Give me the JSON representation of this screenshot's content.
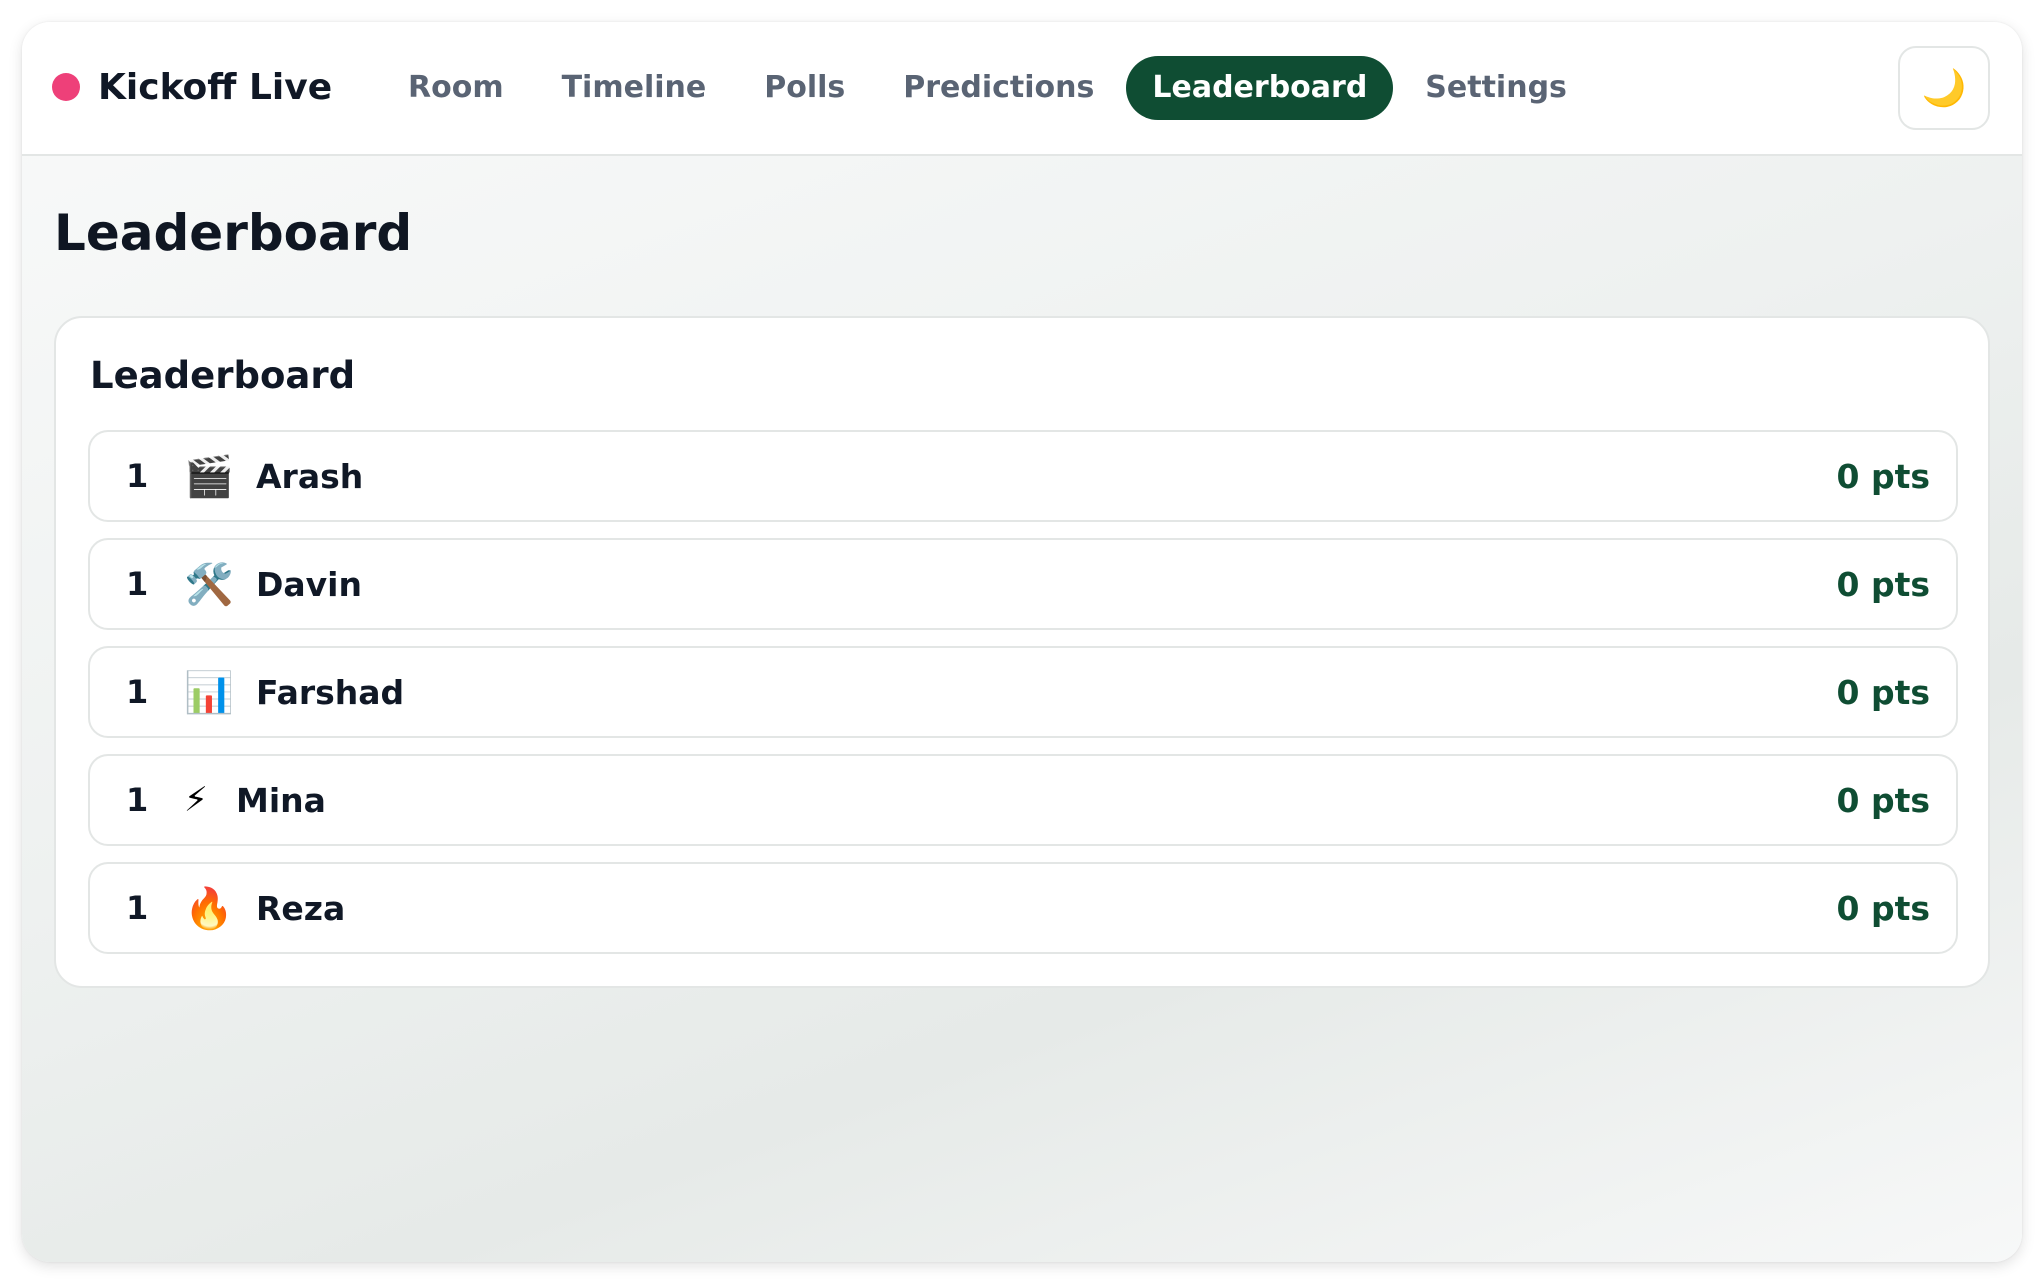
{
  "app": {
    "brand": "Kickoff Live",
    "theme_toggle_icon": "🌙"
  },
  "nav": [
    {
      "label": "Room",
      "active": false
    },
    {
      "label": "Timeline",
      "active": false
    },
    {
      "label": "Polls",
      "active": false
    },
    {
      "label": "Predictions",
      "active": false
    },
    {
      "label": "Leaderboard",
      "active": true
    },
    {
      "label": "Settings",
      "active": false
    }
  ],
  "page": {
    "title": "Leaderboard"
  },
  "leaderboard": {
    "title": "Leaderboard",
    "rows": [
      {
        "rank": "1",
        "avatar": "🎬",
        "avatar_name": "clapper-board-icon",
        "name": "Arash",
        "points": "0 pts"
      },
      {
        "rank": "1",
        "avatar": "🛠️",
        "avatar_name": "tools-icon",
        "name": "Davin",
        "points": "0 pts"
      },
      {
        "rank": "1",
        "avatar": "📊",
        "avatar_name": "bar-chart-icon",
        "name": "Farshad",
        "points": "0 pts"
      },
      {
        "rank": "1",
        "avatar": "⚡",
        "avatar_name": "lightning-icon",
        "name": "Mina",
        "points": "0 pts"
      },
      {
        "rank": "1",
        "avatar": "🔥",
        "avatar_name": "fire-icon",
        "name": "Reza",
        "points": "0 pts"
      }
    ]
  },
  "colors": {
    "accent": "#0f4d33",
    "brand_dot": "#ee4079",
    "text": "#101826",
    "nav_text": "#5a6474"
  }
}
